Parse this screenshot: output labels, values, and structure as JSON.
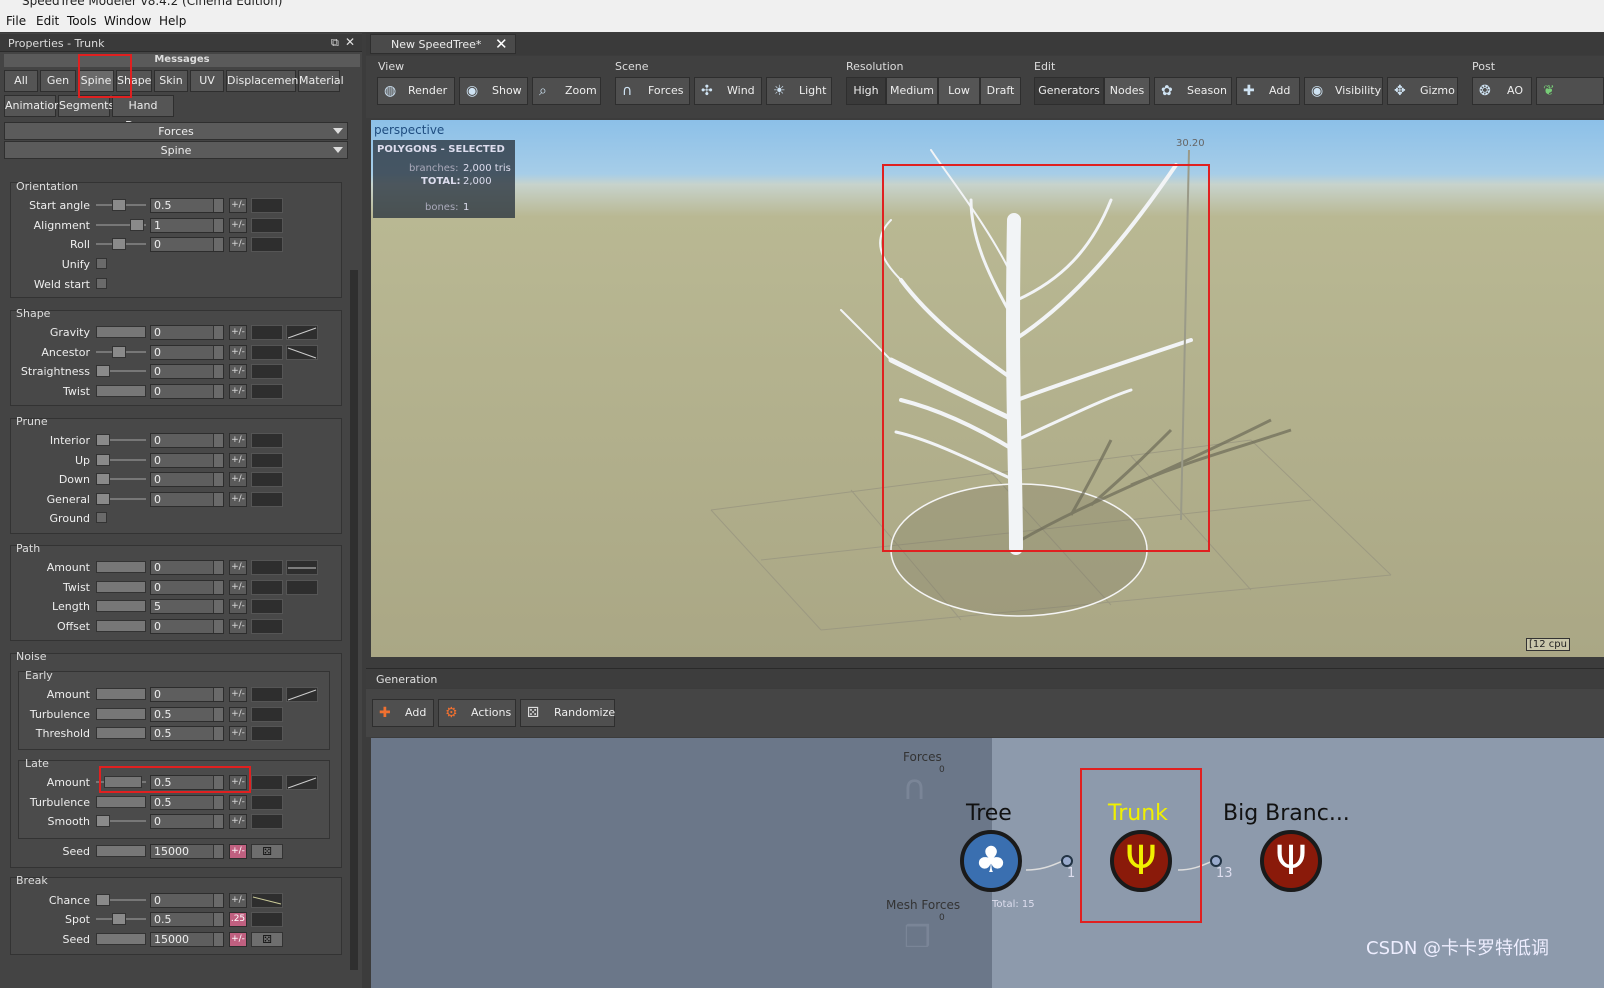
{
  "window": {
    "title": "SpeedTree Modeler v8.4.2 (Cinema Edition)"
  },
  "menu": [
    "File",
    "Edit",
    "Tools",
    "Window",
    "Help"
  ],
  "properties": {
    "title": "Properties - Trunk",
    "messages_label": "Messages",
    "tabs_row1": [
      "All",
      "Gen",
      "Spine",
      "Shape",
      "Skin",
      "UV",
      "Displacement",
      "Material"
    ],
    "tabs_row2": [
      "Animation",
      "Segments",
      "Hand Drawn"
    ],
    "selected_tab": "Spine",
    "sections": [
      "Forces",
      "Spine"
    ],
    "orientation": {
      "title": "Orientation",
      "start_angle": {
        "label": "Start angle",
        "value": "0.5"
      },
      "alignment": {
        "label": "Alignment",
        "value": "1"
      },
      "roll": {
        "label": "Roll",
        "value": "0"
      },
      "unify": {
        "label": "Unify"
      },
      "weld_start": {
        "label": "Weld start"
      }
    },
    "shape": {
      "title": "Shape",
      "gravity": {
        "label": "Gravity",
        "value": "0"
      },
      "ancestor": {
        "label": "Ancestor",
        "value": "0"
      },
      "straightness": {
        "label": "Straightness",
        "value": "0"
      },
      "twist": {
        "label": "Twist",
        "value": "0"
      }
    },
    "prune": {
      "title": "Prune",
      "interior": {
        "label": "Interior",
        "value": "0"
      },
      "up": {
        "label": "Up",
        "value": "0"
      },
      "down": {
        "label": "Down",
        "value": "0"
      },
      "general": {
        "label": "General",
        "value": "0"
      },
      "ground": {
        "label": "Ground"
      }
    },
    "path": {
      "title": "Path",
      "amount": {
        "label": "Amount",
        "value": "0"
      },
      "twist": {
        "label": "Twist",
        "value": "0"
      },
      "length": {
        "label": "Length",
        "value": "5"
      },
      "offset": {
        "label": "Offset",
        "value": "0"
      }
    },
    "noise": {
      "title": "Noise",
      "early": {
        "title": "Early",
        "amount": {
          "label": "Amount",
          "value": "0"
        },
        "turbulence": {
          "label": "Turbulence",
          "value": "0.5"
        },
        "threshold": {
          "label": "Threshold",
          "value": "0.5"
        }
      },
      "late": {
        "title": "Late",
        "amount": {
          "label": "Amount",
          "value": "0.5"
        },
        "turbulence": {
          "label": "Turbulence",
          "value": "0.5"
        },
        "smooth": {
          "label": "Smooth",
          "value": "0"
        }
      },
      "seed": {
        "label": "Seed",
        "value": "15000"
      }
    },
    "break": {
      "title": "Break",
      "chance": {
        "label": "Chance",
        "value": "0"
      },
      "spot": {
        "label": "Spot",
        "value": "0.5",
        "pm": ".25"
      },
      "seed": {
        "label": "Seed",
        "value": "15000"
      }
    },
    "pm_label": "+/-"
  },
  "document": {
    "tab_label": "New SpeedTree*"
  },
  "toolbar": {
    "view": {
      "title": "View",
      "render": "Render",
      "show": "Show",
      "zoom": "Zoom"
    },
    "scene": {
      "title": "Scene",
      "forces": "Forces",
      "wind": "Wind",
      "light": "Light"
    },
    "resolution": {
      "title": "Resolution",
      "high": "High",
      "medium": "Medium",
      "low": "Low",
      "draft": "Draft"
    },
    "edit": {
      "title": "Edit",
      "generators": "Generators",
      "nodes": "Nodes",
      "season": "Season",
      "add": "Add",
      "visibility": "Visibility",
      "gizmo": "Gizmo"
    },
    "post": {
      "title": "Post",
      "ao": "AO"
    }
  },
  "viewport": {
    "label": "perspective",
    "stats_title": "POLYGONS - SELECTED",
    "branches_label": "branches:",
    "branches_value": "2,000 tris",
    "total_label": "TOTAL:",
    "total_value": "2,000",
    "bones_label": "bones:",
    "bones_value": "1",
    "height_marker": "30.20",
    "cpu": "[12 cpu"
  },
  "generation": {
    "title": "Generation",
    "add": "Add",
    "actions": "Actions",
    "randomize": "Randomize",
    "forces_label": "Forces",
    "forces_count": "0",
    "mesh_forces_label": "Mesh Forces",
    "mesh_forces_count": "0",
    "nodes": {
      "tree": {
        "label": "Tree",
        "total": "Total: 15"
      },
      "trunk": {
        "label": "Trunk",
        "count": "1"
      },
      "big_branches": {
        "label": "Big Branc...",
        "count": "13"
      }
    }
  },
  "watermark": "CSDN @卡卡罗特低调",
  "colors": {
    "accent_red": "#e02020",
    "trunk_yellow": "#f0f000",
    "node_red": "#8a1a0a",
    "tree_blue": "#3a6fb0"
  }
}
